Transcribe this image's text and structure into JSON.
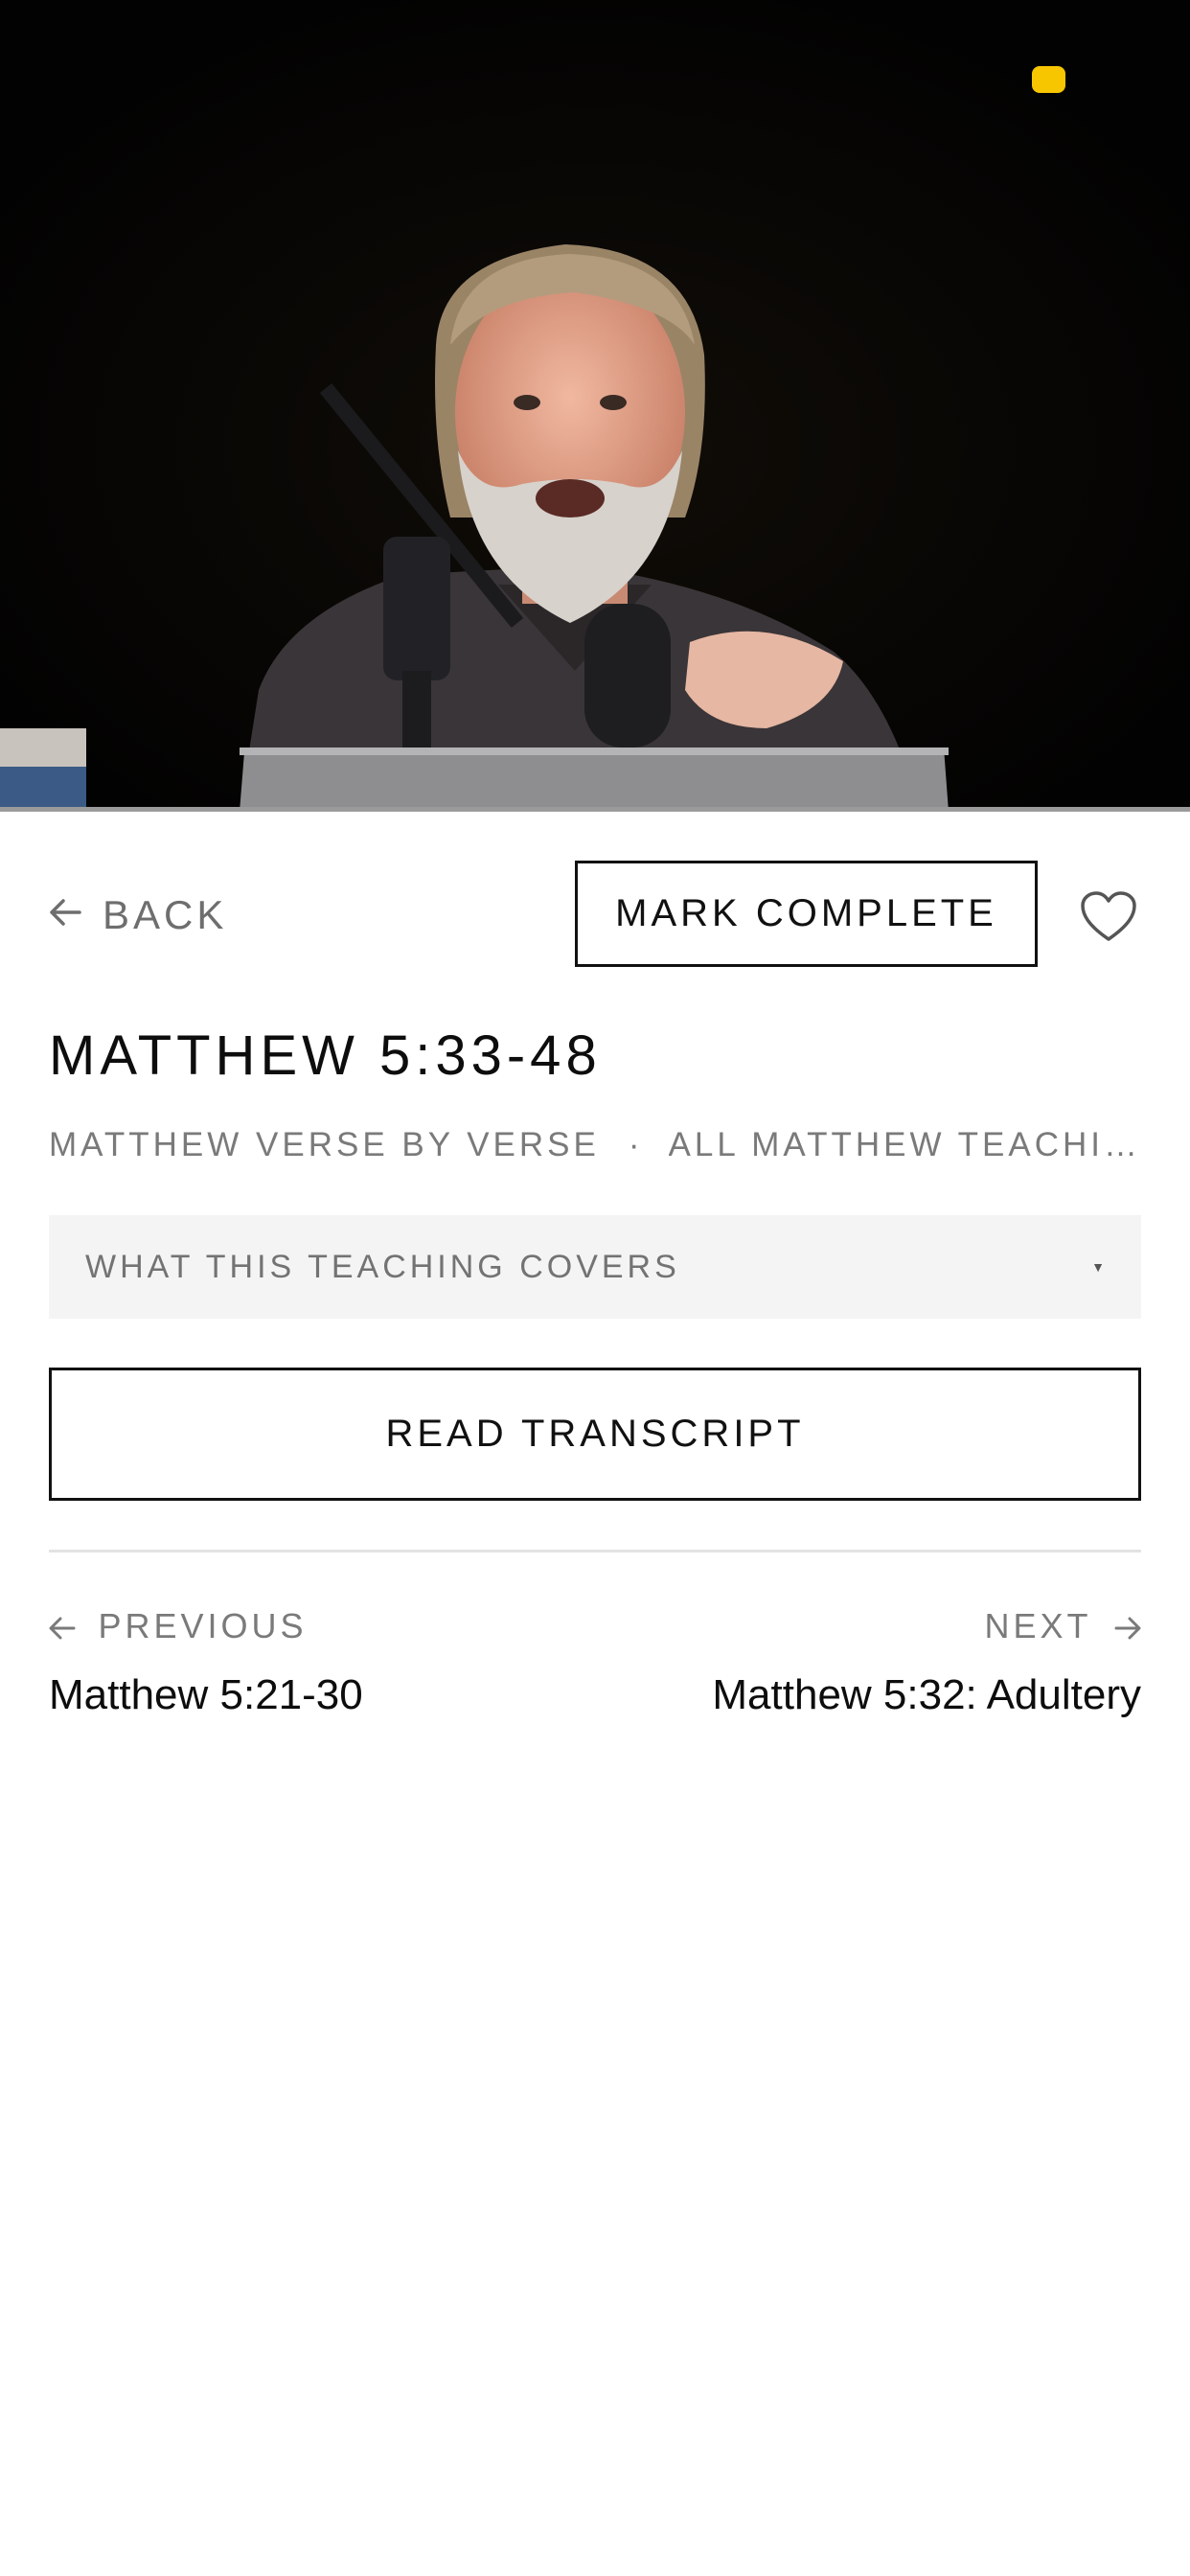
{
  "video": {
    "indicator_color": "#f7c600"
  },
  "actions": {
    "back_label": "BACK",
    "back_icon": "arrow-left-icon",
    "mark_complete_label": "MARK COMPLETE",
    "favorite_icon": "heart-icon"
  },
  "teaching": {
    "title": "MATTHEW 5:33-48",
    "breadcrumb": {
      "series": "MATTHEW VERSE BY VERSE",
      "separator": "·",
      "collection": "ALL MATTHEW TEACHINGS"
    }
  },
  "covers_dropdown": {
    "label": "WHAT THIS TEACHING COVERS",
    "caret": "▼"
  },
  "transcript_button": {
    "label": "READ TRANSCRIPT"
  },
  "navigation": {
    "previous": {
      "kicker": "PREVIOUS",
      "title": "Matthew 5:21-30"
    },
    "next": {
      "kicker": "NEXT",
      "title": "Matthew 5:32: Adultery"
    }
  }
}
